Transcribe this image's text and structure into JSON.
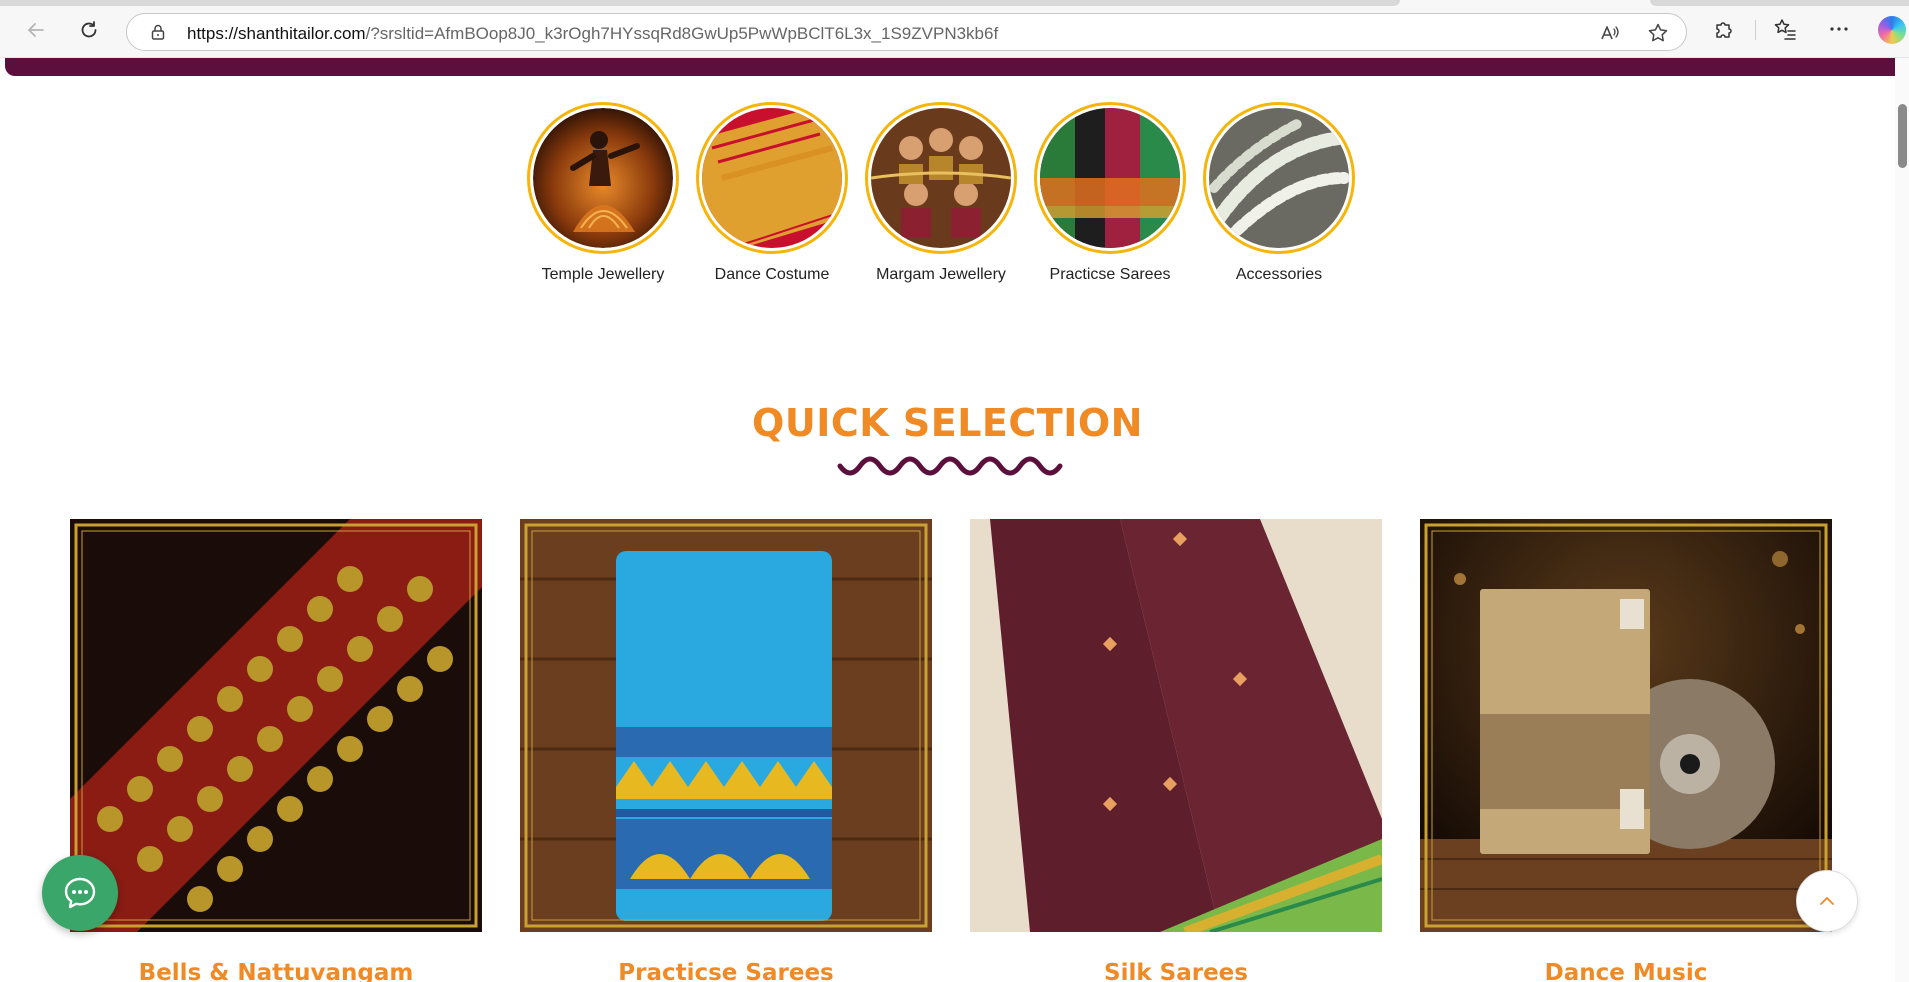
{
  "browser": {
    "url_host": "https://shanthitailor.com",
    "url_rest": "/?srsltid=AfmBOop8J0_k3rOgh7HYssqRd8GwUp5PwWpBClT6L3x_1S9ZVPN3kb6f"
  },
  "categories": [
    {
      "label": "Temple Jewellery"
    },
    {
      "label": "Dance Costume"
    },
    {
      "label": "Margam Jewellery"
    },
    {
      "label": "Practicse Sarees"
    },
    {
      "label": "Accessories"
    }
  ],
  "quick_selection": {
    "title": "QUICK SELECTION",
    "products": [
      {
        "name": "Bells & Nattuvangam"
      },
      {
        "name": "Practicse Sarees"
      },
      {
        "name": "Silk Sarees"
      },
      {
        "name": "Dance Music"
      }
    ]
  },
  "colors": {
    "accent": "#f08a24",
    "brand": "#5c0f3d",
    "chat": "#3aa66a",
    "gold": "#f5b50a"
  },
  "icons": {
    "back": "arrow-left-icon",
    "refresh": "refresh-icon",
    "lock": "lock-icon",
    "read_aloud": "read-aloud-icon",
    "favorite": "star-icon",
    "extensions": "puzzle-icon",
    "favorites_bar": "favorites-icon",
    "more": "more-icon",
    "chat": "chat-icon",
    "scroll_top": "chevron-up-icon"
  }
}
